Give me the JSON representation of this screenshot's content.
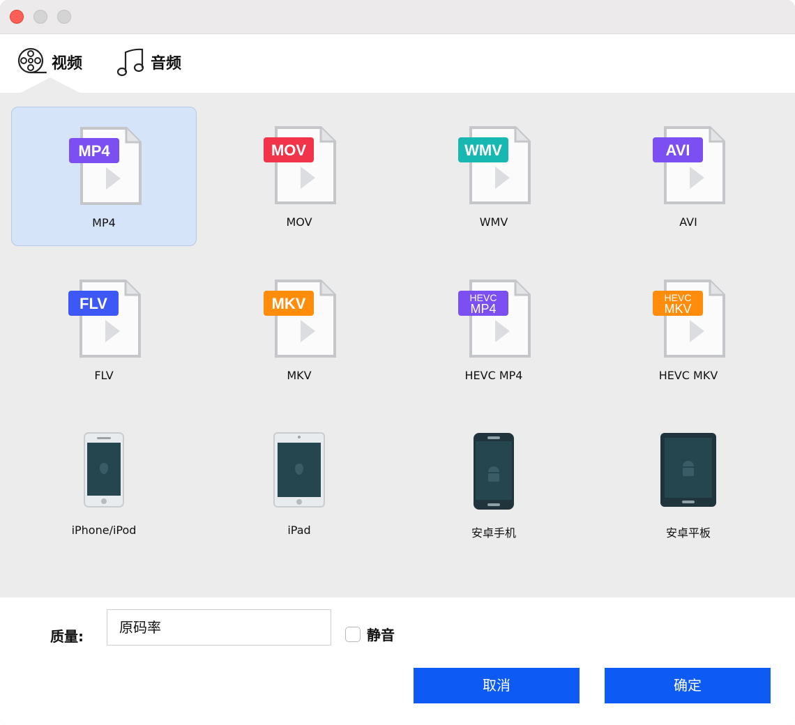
{
  "tabs": [
    {
      "label": "视频",
      "icon": "film-reel-icon",
      "selected": true
    },
    {
      "label": "音频",
      "icon": "music-note-icon",
      "selected": false
    }
  ],
  "formats": [
    {
      "badge": "MP4",
      "label": "MP4",
      "color": "#7b4ff2",
      "selected": true
    },
    {
      "badge": "MOV",
      "label": "MOV",
      "color": "#f2344a",
      "selected": false
    },
    {
      "badge": "WMV",
      "label": "WMV",
      "color": "#17b8b2",
      "selected": false
    },
    {
      "badge": "AVI",
      "label": "AVI",
      "color": "#7b4ff2",
      "selected": false
    },
    {
      "badge": "FLV",
      "label": "FLV",
      "color": "#3d58f5",
      "selected": false
    },
    {
      "badge": "MKV",
      "label": "MKV",
      "color": "#ff8c0a",
      "selected": false
    },
    {
      "badge_top": "HEVC",
      "badge": "MP4",
      "label": "HEVC MP4",
      "color": "#7b4ff2",
      "selected": false
    },
    {
      "badge_top": "HEVC",
      "badge": "MKV",
      "label": "HEVC MKV",
      "color": "#ff8c0a",
      "selected": false
    }
  ],
  "devices": [
    {
      "label": "iPhone/iPod",
      "icon": "iphone-icon"
    },
    {
      "label": "iPad",
      "icon": "ipad-icon"
    },
    {
      "label": "安卓手机",
      "icon": "android-phone-icon"
    },
    {
      "label": "安卓平板",
      "icon": "android-tablet-icon"
    }
  ],
  "quality": {
    "label": "质量:",
    "value": "原码率"
  },
  "mute": {
    "label": "静音",
    "checked": false
  },
  "buttons": {
    "cancel": "取消",
    "ok": "确定"
  },
  "colors": {
    "accent": "#0d5bf4",
    "selected_bg": "#d6e4f9"
  }
}
